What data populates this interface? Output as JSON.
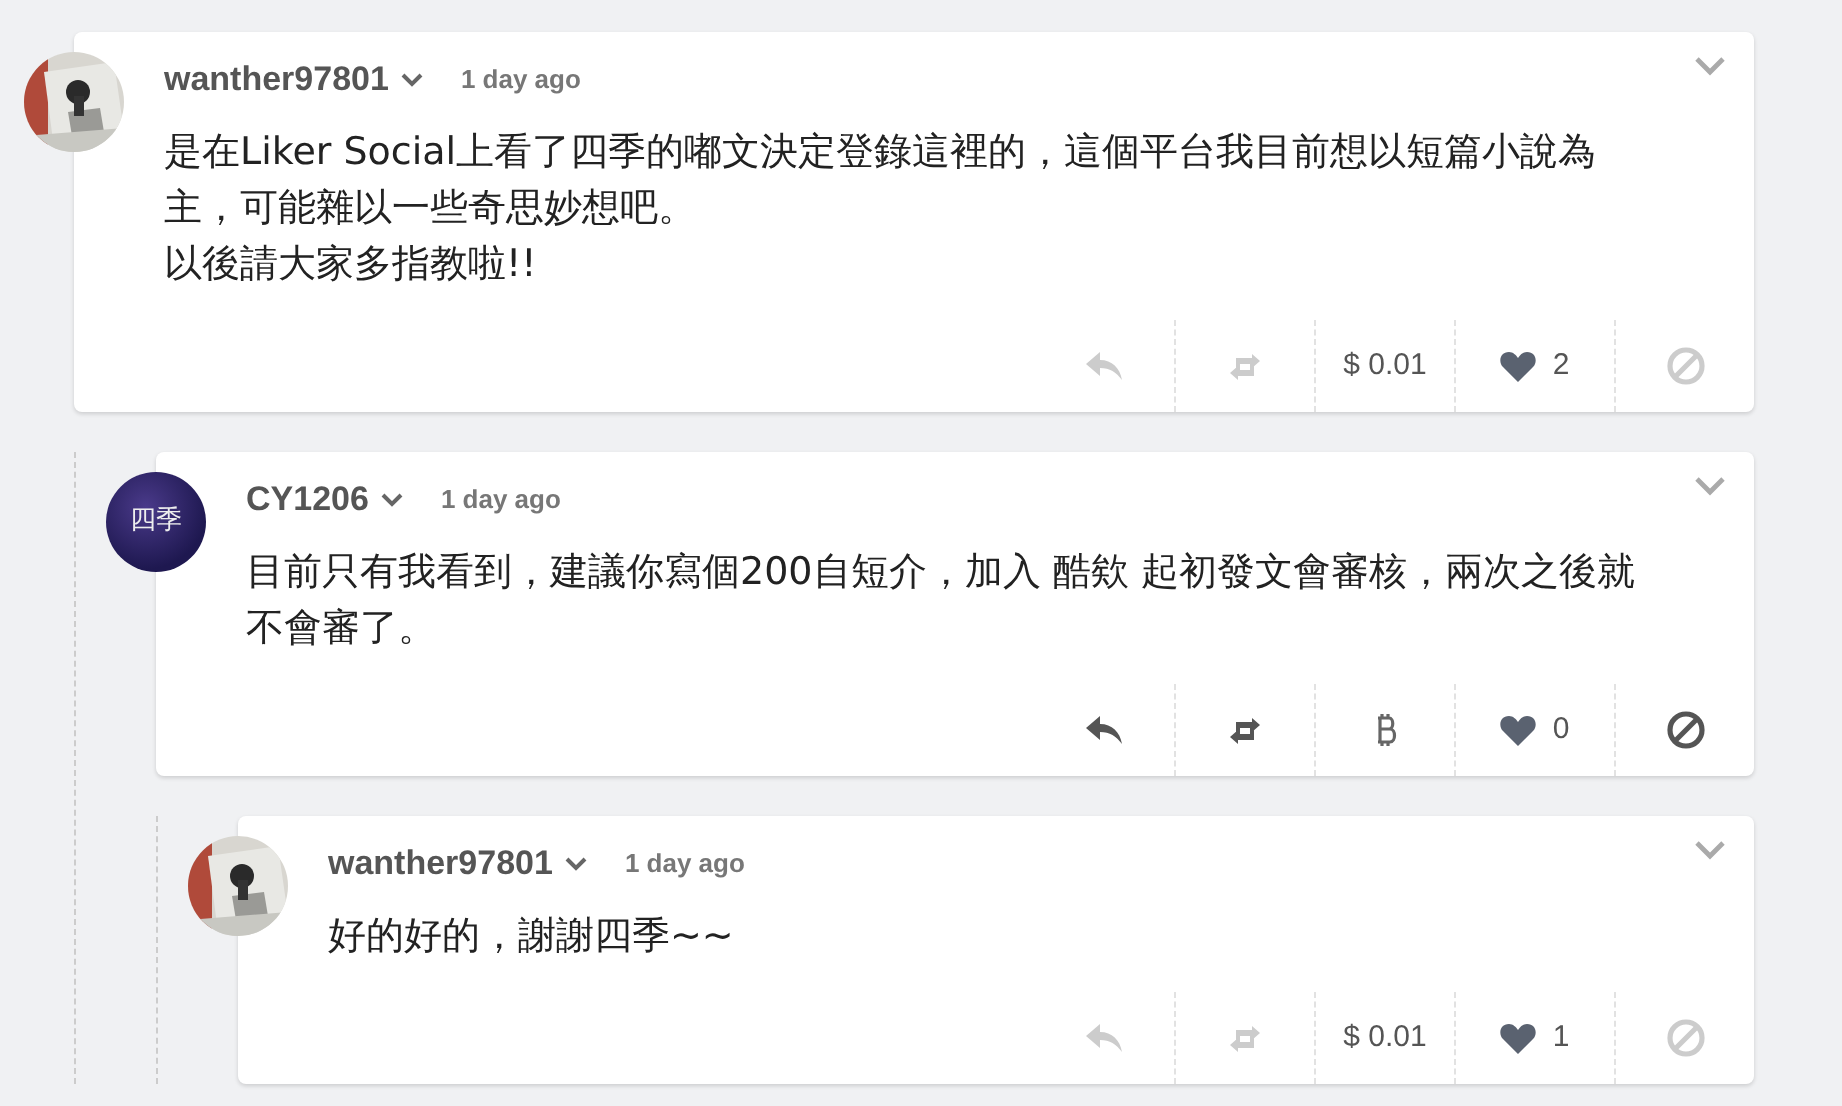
{
  "comments": [
    {
      "author": "wanther97801",
      "time": "1 day ago",
      "avatar": {
        "kind": "picture"
      },
      "body": [
        "是在Liker Social上看了四季的嘟文決定登錄這裡的，這個平台我目前想以短篇小說為主，可能雜以一些奇思妙想吧。",
        "以後請大家多指教啦!!"
      ],
      "actions_enabled": false,
      "tip": {
        "kind": "amount",
        "text": "$ 0.01"
      },
      "likes": "2",
      "children": [
        {
          "author": "CY1206",
          "time": "1 day ago",
          "avatar": {
            "kind": "text",
            "text": "四季"
          },
          "body": [
            "目前只有我看到，建議你寫個200自短介，加入 酷欸 起初發文會審核，兩次之後就不會審了。"
          ],
          "actions_enabled": true,
          "tip": {
            "kind": "bitcoin"
          },
          "likes": "0",
          "children": [
            {
              "author": "wanther97801",
              "time": "1 day ago",
              "avatar": {
                "kind": "picture"
              },
              "body": [
                "好的好的，謝謝四季~~"
              ],
              "actions_enabled": false,
              "tip": {
                "kind": "amount",
                "text": "$ 0.01"
              },
              "likes": "1"
            }
          ]
        }
      ]
    }
  ]
}
